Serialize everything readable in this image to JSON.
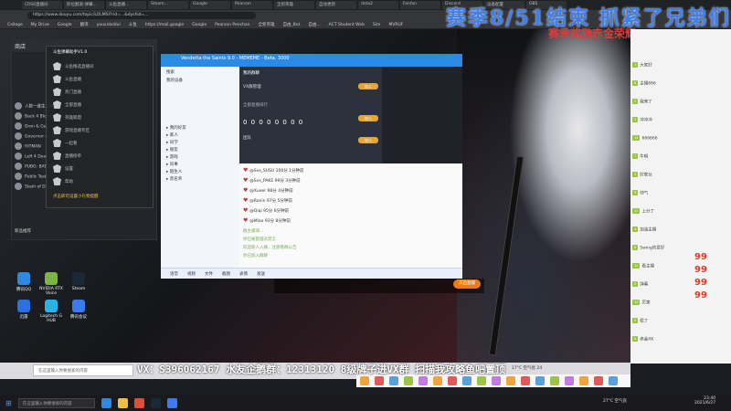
{
  "browser": {
    "tabs": [
      "CRS6直播间",
      "阶位翻滚-弹幕...",
      "斗鱼直播...",
      "Steam...",
      "Google",
      "Pearson",
      "全新英雄",
      "自动更新",
      "dota2",
      "Fanfan",
      "Discord",
      "设备配置",
      "OBS"
    ],
    "url": "https://www.douyu.com/topic/LOLMSI?rid=...&dyshid=...",
    "bookmarks": [
      "College",
      "My Drive",
      "Google",
      "翻译",
      "youxiduidui",
      "斗鱼",
      "https://mail.google",
      "Google",
      "Pearson Penchan",
      "全新英雄",
      "自由_Bot",
      "自由...",
      "ACT Student Web",
      "Sim",
      "MVRUF"
    ]
  },
  "stream": {
    "heading": "赛季8/51结束 抓紧了兄弟们",
    "subheading": "赛季奖励赤金荣耀AK",
    "marquee": "VX：S396062167 水友企鹅群：12313120 8级牌子进VX群 扫描我攻略鱼吧置顶",
    "join_button": "开启直播"
  },
  "douyu_panel": {
    "header": "商店",
    "items": [
      "人数一维生活体",
      "Back 4 Blood",
      "Dron & Gun",
      "Governor of Poker",
      "HITMAN",
      "Left 4 Dead",
      "PUBG: BATTLEGROUNDS",
      "Public Test",
      "Slash of Dragon"
    ],
    "bottom": "新品推荐"
  },
  "popup": {
    "title": "斗鱼弹幕助手V1.0",
    "items": [
      "斗鱼精选直播间",
      "斗鱼直播",
      "热门直播",
      "全部直播",
      "英雄联盟",
      "游戏直播专区",
      "一起看",
      "直播榜单",
      "设置",
      "帮助"
    ],
    "footer": "点击即可设置小礼物提醒"
  },
  "desktop_icons": [
    {
      "label": "腾讯QQ",
      "color": "#2d8ae3"
    },
    {
      "label": "NVIDIA RTX Voice",
      "color": "#7bb545"
    },
    {
      "label": "Steam",
      "color": "#1b2838"
    },
    {
      "label": "迅雷",
      "color": "#2b6fe0"
    },
    {
      "label": "Logitech G HUB",
      "color": "#2ab4e6"
    },
    {
      "label": "腾讯会议",
      "color": "#3a7cf0"
    }
  ],
  "qq": {
    "title": "Vendetta the Saints 9.0 - MEMEME - Beta, 3000",
    "search": "搜索",
    "my_device": "我的设备",
    "contacts": [
      "我的好友",
      "家人",
      "同学",
      "朋友",
      "游戏",
      "同事",
      "陌生人",
      "黑名单"
    ],
    "groups_header": "我的群聊",
    "group_name": "VX群管理",
    "rank_title": "全部直播排行",
    "rank_value": "0 0 0 0 0 0 0 0",
    "group_btn": "加入",
    "team_label": "团队",
    "chat_lines": [
      "@Svs_SUSU 100分 1分钟前",
      "@Svs_PAKE 99分 3分钟前",
      "@Xueer 98分 4分钟前",
      "@Ronin 97分 5分钟前",
      "@Qiqi 95分 6分钟前",
      "@Miao 93分 8分钟前"
    ],
    "system_msgs": [
      "群主邀请...",
      "你已被管理员禁言",
      "欢迎新人入群，注意看群公告",
      "你已加入群聊"
    ],
    "bottom": [
      "语音",
      "视频",
      "文件",
      "截图",
      "表情",
      "发送"
    ]
  },
  "right_chat": {
    "messages": [
      {
        "badge": "1",
        "text": "大家好"
      },
      {
        "badge": "8",
        "text": "主播666"
      },
      {
        "badge": "2",
        "text": "我来了"
      },
      {
        "badge": "5",
        "text": "冲冲冲"
      },
      {
        "badge": "12",
        "text": "666666"
      },
      {
        "badge": "7",
        "text": "牛啊"
      },
      {
        "badge": "3",
        "text": "好家伙"
      },
      {
        "badge": "9",
        "text": "帅气"
      },
      {
        "badge": "11",
        "text": "上分了"
      },
      {
        "badge": "4",
        "text": "加油主播"
      },
      {
        "badge": "6",
        "text": "Swing的爱好"
      },
      {
        "badge": "14",
        "text": "看主播"
      },
      {
        "badge": "2",
        "text": "弹幕"
      },
      {
        "badge": "10",
        "text": "厉害"
      },
      {
        "badge": "5",
        "text": "稳了"
      },
      {
        "badge": "8",
        "text": "赤金AK"
      }
    ],
    "big99": [
      "99",
      "99",
      "99",
      "99"
    ]
  },
  "inner_taskbar": {
    "search": "在这里输入你要搜索的内容",
    "temp": "17°C 空气优 24"
  },
  "outer_taskbar": {
    "search": "在这里输入你要搜索的内容",
    "weather": "27°C 空气良",
    "time": "23:40",
    "date": "2021/6/27"
  }
}
